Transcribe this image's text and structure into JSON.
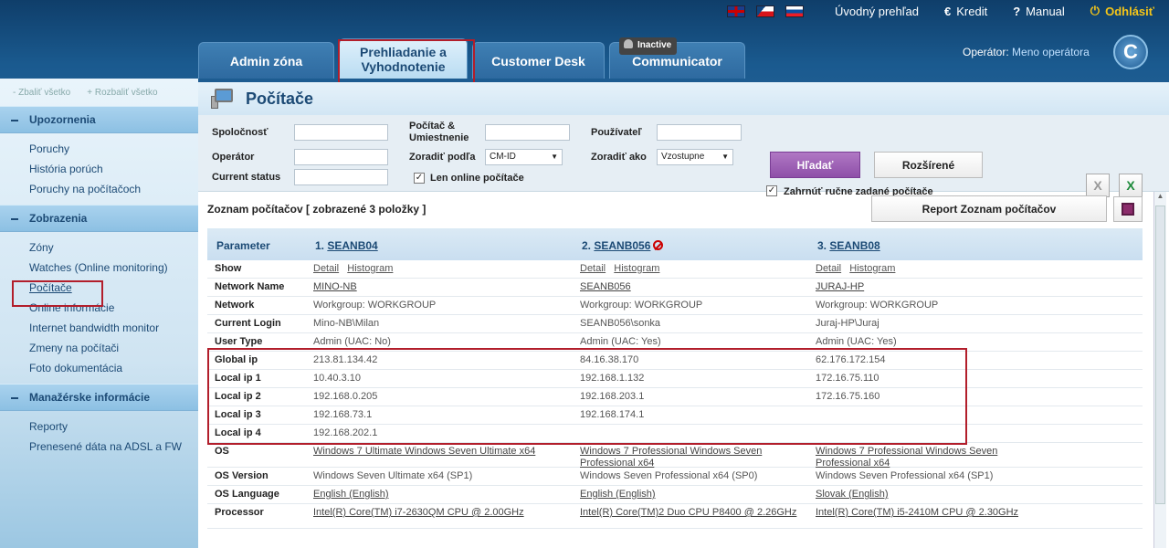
{
  "topnav": {
    "home": "Úvodný prehľad",
    "credit": "Kredit",
    "manual": "Manual",
    "logout": "Odhlásiť"
  },
  "tabs": [
    {
      "label": "Admin zóna"
    },
    {
      "label": "Prehliadanie a Vyhodnotenie"
    },
    {
      "label": "Customer Desk"
    },
    {
      "label": "Communicator"
    }
  ],
  "inactive_badge": "Inactive",
  "operator": {
    "label": "Operátor:",
    "name": "Meno operátora"
  },
  "sidebar": {
    "collapse_all": "Zbaliť všetko",
    "expand_all": "Rozbaliť všetko",
    "sections": [
      {
        "title": "Upozornenia",
        "items": [
          "Poruchy",
          "História porúch",
          "Poruchy na počítačoch"
        ]
      },
      {
        "title": "Zobrazenia",
        "items": [
          "Zóny",
          "Watches (Online monitoring)",
          "Počítače",
          "Online informácie",
          "Internet bandwidth monitor",
          "Zmeny na počítači",
          "Foto dokumentácia"
        ]
      },
      {
        "title": "Manažérske informácie",
        "items": [
          "Reporty",
          "Prenesené dáta na ADSL a FW"
        ]
      }
    ]
  },
  "page_title": "Počítače",
  "filters": {
    "company": "Spoločnosť",
    "pc_location": "Počítač & Umiestnenie",
    "user": "Používateľ",
    "operator": "Operátor",
    "sort_by": "Zoradiť podľa",
    "sort_by_value": "CM-ID",
    "sort_as": "Zoradiť ako",
    "sort_as_value": "Vzostupne",
    "current_status": "Current status",
    "online_only": "Len online počítače",
    "include_manual": "Zahrnúť ručne zadané počítače",
    "search_btn": "Hľadať",
    "advanced_btn": "Rozšírené"
  },
  "list": {
    "title": "Zoznam počítačov",
    "count_text": "[ zobrazené 3 položky ]",
    "report_btn": "Report Zoznam počítačov"
  },
  "table": {
    "param_header": "Parameter",
    "columns": [
      {
        "num": "1.",
        "name": "SEANB04"
      },
      {
        "num": "2.",
        "name": "SEANB056"
      },
      {
        "num": "3.",
        "name": "SEANB08"
      }
    ],
    "show_links": [
      "Detail",
      "Histogram"
    ],
    "rows": [
      {
        "key": "Network Name",
        "vals": [
          "MINO-NB",
          "SEANB056",
          "JURAJ-HP"
        ]
      },
      {
        "key": "Network",
        "vals": [
          "Workgroup: WORKGROUP",
          "Workgroup: WORKGROUP",
          "Workgroup: WORKGROUP"
        ]
      },
      {
        "key": "Current Login",
        "vals": [
          "Mino-NB\\Milan",
          "SEANB056\\sonka",
          "Juraj-HP\\Juraj"
        ]
      },
      {
        "key": "User Type",
        "vals": [
          "Admin (UAC: No)",
          "Admin (UAC: Yes)",
          "Admin (UAC: Yes)"
        ]
      },
      {
        "key": "Global ip",
        "vals": [
          "213.81.134.42",
          "84.16.38.170",
          "62.176.172.154"
        ]
      },
      {
        "key": "Local ip 1",
        "vals": [
          "10.40.3.10",
          "192.168.1.132",
          "172.16.75.110"
        ]
      },
      {
        "key": "Local ip 2",
        "vals": [
          "192.168.0.205",
          "192.168.203.1",
          "172.16.75.160"
        ]
      },
      {
        "key": "Local ip 3",
        "vals": [
          "192.168.73.1",
          "192.168.174.1",
          ""
        ]
      },
      {
        "key": "Local ip 4",
        "vals": [
          "192.168.202.1",
          "",
          ""
        ]
      },
      {
        "key": "OS",
        "vals": [
          "Windows 7 Ultimate Windows Seven Ultimate x64",
          "Windows 7 Professional Windows Seven Professional x64",
          "Windows 7 Professional Windows Seven Professional x64"
        ]
      },
      {
        "key": "OS Version",
        "vals": [
          "Windows Seven Ultimate x64 (SP1)",
          "Windows Seven Professional x64 (SP0)",
          "Windows Seven Professional x64 (SP1)"
        ]
      },
      {
        "key": "OS Language",
        "vals": [
          "English (English)",
          "English (English)",
          "Slovak (English)"
        ]
      },
      {
        "key": "Processor",
        "vals": [
          "Intel(R) Core(TM) i7-2630QM CPU @ 2.00GHz",
          "Intel(R) Core(TM)2 Duo CPU P8400 @ 2.26GHz",
          "Intel(R) Core(TM) i5-2410M CPU @ 2.30GHz"
        ]
      }
    ],
    "show_key": "Show"
  },
  "colors": {
    "highlight": "#b21e2b",
    "search_btn": "#9b5db5",
    "header_bg": "#1a5a8f"
  }
}
